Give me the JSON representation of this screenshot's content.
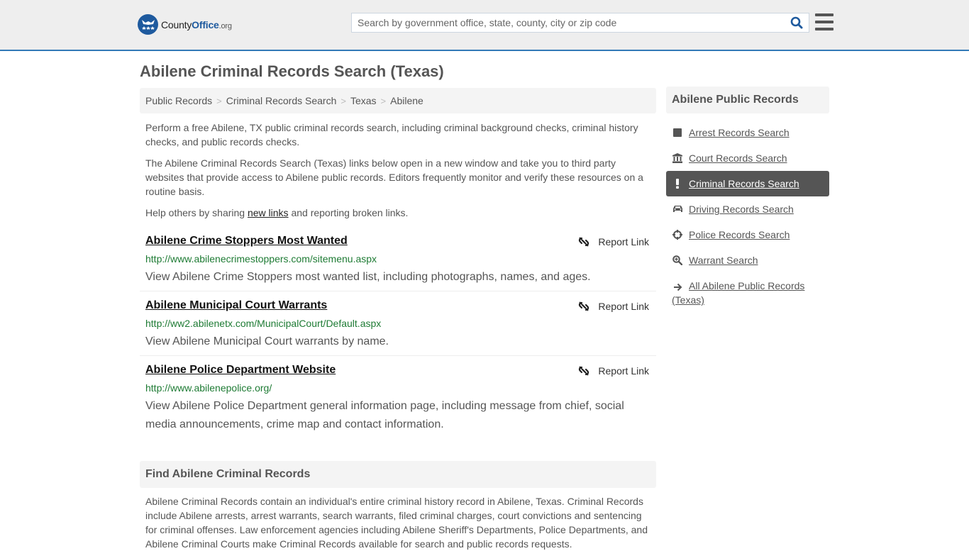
{
  "header": {
    "logo": {
      "county": "County",
      "office": "Office",
      "org": ".org"
    },
    "search_placeholder": "Search by government office, state, county, city or zip code",
    "search_value": "",
    "colors": {
      "accent": "#337ab7",
      "brand": "#1e5a9e",
      "url_green": "#1e7b34"
    }
  },
  "page_title": "Abilene Criminal Records Search (Texas)",
  "breadcrumb": [
    "Public Records",
    "Criminal Records Search",
    "Texas",
    "Abilene"
  ],
  "intro": {
    "p1": "Perform a free Abilene, TX public criminal records search, including criminal background checks, criminal history checks, and public records checks.",
    "p2": "The Abilene Criminal Records Search (Texas) links below open in a new window and take you to third party websites that provide access to Abilene public records. Editors frequently monitor and verify these resources on a routine basis.",
    "p3_before": "Help others by sharing ",
    "p3_link": "new links",
    "p3_after": " and reporting broken links."
  },
  "results": [
    {
      "title": "Abilene Crime Stoppers Most Wanted",
      "url": "http://www.abilenecrimestoppers.com/sitemenu.aspx",
      "description": "View Abilene Crime Stoppers most wanted list, including photographs, names, and ages.",
      "report_label": "Report Link"
    },
    {
      "title": "Abilene Municipal Court Warrants",
      "url": "http://ww2.abilenetx.com/MunicipalCourt/Default.aspx",
      "description": "View Abilene Municipal Court warrants by name.",
      "report_label": "Report Link"
    },
    {
      "title": "Abilene Police Department Website",
      "url": "http://www.abilenepolice.org/",
      "description": "View Abilene Police Department general information page, including message from chief, social media announcements, crime map and contact information.",
      "report_label": "Report Link"
    }
  ],
  "find_section": {
    "heading": "Find Abilene Criminal Records",
    "body": "Abilene Criminal Records contain an individual's entire criminal history record in Abilene, Texas. Criminal Records include Abilene arrests, arrest warrants, search warrants, filed criminal charges, court convictions and sentencing for criminal offenses. Law enforcement agencies including Abilene Sheriff's Departments, Police Departments, and Abilene Criminal Courts make Criminal Records available for search and public records requests."
  },
  "sidebar": {
    "heading": "Abilene Public Records",
    "items": [
      {
        "label": "Arrest Records Search",
        "icon": "square-icon",
        "active": false
      },
      {
        "label": "Court Records Search",
        "icon": "courthouse-icon",
        "active": false
      },
      {
        "label": "Criminal Records Search",
        "icon": "exclamation-icon",
        "active": true
      },
      {
        "label": "Driving Records Search",
        "icon": "car-icon",
        "active": false
      },
      {
        "label": "Police Records Search",
        "icon": "crosshairs-icon",
        "active": false
      },
      {
        "label": "Warrant Search",
        "icon": "search-plus-icon",
        "active": false
      },
      {
        "label": "All Abilene Public Records (Texas)",
        "icon": "arrow-right-icon",
        "active": false
      }
    ]
  }
}
